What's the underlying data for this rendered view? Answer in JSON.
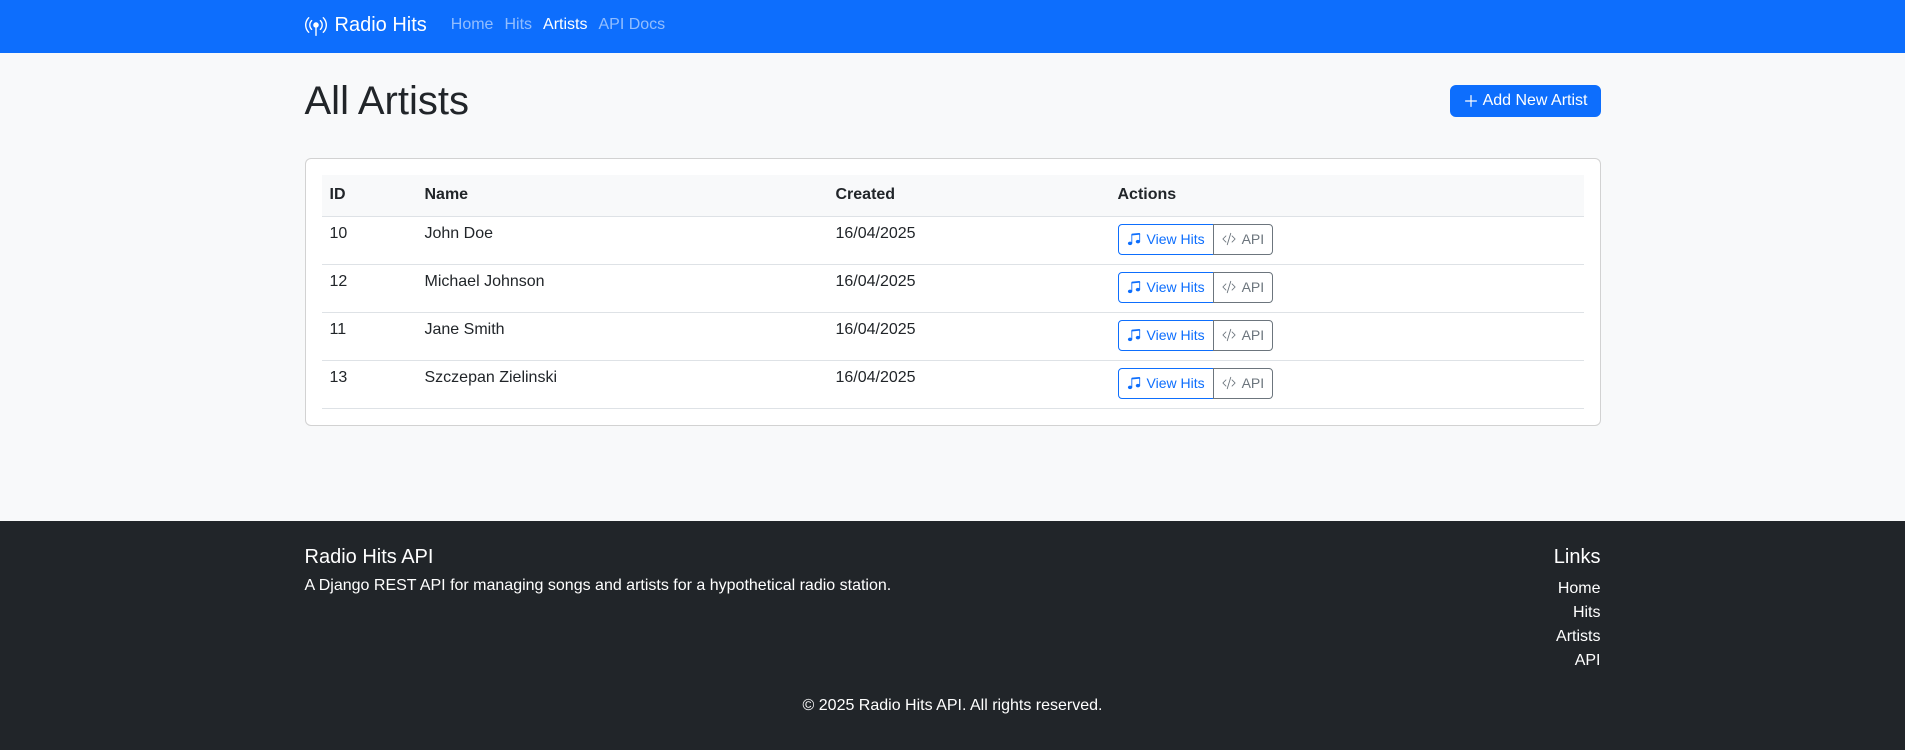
{
  "nav": {
    "brand": "Radio Hits",
    "links": [
      {
        "label": "Home",
        "active": false
      },
      {
        "label": "Hits",
        "active": false
      },
      {
        "label": "Artists",
        "active": true
      },
      {
        "label": "API Docs",
        "active": false
      }
    ]
  },
  "page": {
    "title": "All Artists",
    "add_button": "Add New Artist"
  },
  "table": {
    "headers": [
      "ID",
      "Name",
      "Created",
      "Actions"
    ],
    "rows": [
      {
        "id": "10",
        "name": "John Doe",
        "created": "16/04/2025"
      },
      {
        "id": "12",
        "name": "Michael Johnson",
        "created": "16/04/2025"
      },
      {
        "id": "11",
        "name": "Jane Smith",
        "created": "16/04/2025"
      },
      {
        "id": "13",
        "name": "Szczepan Zielinski",
        "created": "16/04/2025"
      }
    ],
    "view_hits_label": "View Hits",
    "api_label": "API"
  },
  "footer": {
    "title": "Radio Hits API",
    "description": "A Django REST API for managing songs and artists for a hypothetical radio station.",
    "links_title": "Links",
    "links": [
      "Home",
      "Hits",
      "Artists",
      "API"
    ],
    "copyright": "© 2025 Radio Hits API. All rights reserved."
  },
  "colors": {
    "primary": "#0d6efd",
    "secondary": "#6c757d",
    "footer_bg": "#212529",
    "page_bg": "#f8f9fa"
  }
}
